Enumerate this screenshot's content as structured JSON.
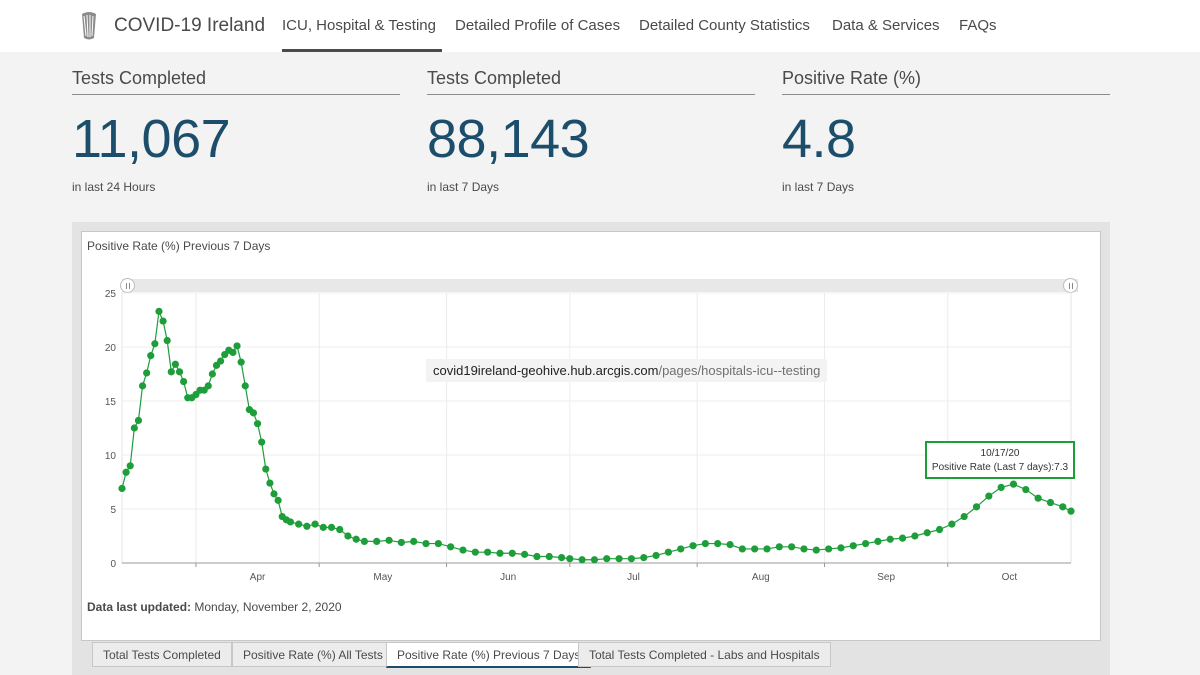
{
  "nav": {
    "site_title": "COVID-19 Ireland",
    "links": [
      "ICU, Hospital & Testing",
      "Detailed Profile of Cases",
      "Detailed County Statistics",
      "Data & Services",
      "FAQs"
    ],
    "active_index": 0
  },
  "cards": [
    {
      "title": "Tests Completed",
      "value": "11,067",
      "sub": "in last 24 Hours"
    },
    {
      "title": "Tests Completed",
      "value": "88,143",
      "sub": "in last 7 Days"
    },
    {
      "title": "Positive Rate (%)",
      "value": "4.8",
      "sub": "in last 7 Days"
    }
  ],
  "chart_panel": {
    "url_tooltip": {
      "domain": "covid19ireland-geohive.hub.arcgis.com",
      "path": "/pages/hospitals-icu--testing"
    },
    "hover_tooltip": {
      "date": "10/17/20",
      "text": "Positive Rate (Last 7 days):7.3"
    },
    "updated_label": "Data last updated:",
    "updated_value": "Monday, November 2, 2020",
    "tabs": [
      "Total Tests Completed",
      "Positive Rate (%) All Tests",
      "Positive Rate (%) Previous 7 Days",
      "Total Tests Completed - Labs and Hospitals"
    ],
    "active_tab": 2
  },
  "colors": {
    "series": "#1e9e3a",
    "value": "#1c4e6b",
    "nav_text": "#4a4a4a"
  },
  "chart_data": {
    "type": "line",
    "title": "Positive Rate (%) Previous 7 Days",
    "xlabel": "",
    "ylabel": "",
    "ylim": [
      0,
      25
    ],
    "yticks": [
      0,
      5,
      10,
      15,
      20,
      25
    ],
    "xticks": [
      {
        "label": "Apr",
        "date": "2020-04-01"
      },
      {
        "label": "May",
        "date": "2020-05-01"
      },
      {
        "label": "Jun",
        "date": "2020-06-01"
      },
      {
        "label": "Jul",
        "date": "2020-07-01"
      },
      {
        "label": "Aug",
        "date": "2020-08-01"
      },
      {
        "label": "Sep",
        "date": "2020-09-01"
      },
      {
        "label": "Oct",
        "date": "2020-10-01"
      }
    ],
    "x_range": [
      "2020-03-14",
      "2020-10-31"
    ],
    "grid": true,
    "series": [
      {
        "points": [
          [
            "2020-03-14",
            6.9
          ],
          [
            "2020-03-15",
            8.4
          ],
          [
            "2020-03-16",
            9
          ],
          [
            "2020-03-17",
            12.5
          ],
          [
            "2020-03-18",
            13.2
          ],
          [
            "2020-03-19",
            16.4
          ],
          [
            "2020-03-20",
            17.6
          ],
          [
            "2020-03-21",
            19.2
          ],
          [
            "2020-03-22",
            20.3
          ],
          [
            "2020-03-23",
            23.3
          ],
          [
            "2020-03-24",
            22.4
          ],
          [
            "2020-03-25",
            20.6
          ],
          [
            "2020-03-26",
            17.7
          ],
          [
            "2020-03-27",
            18.4
          ],
          [
            "2020-03-28",
            17.7
          ],
          [
            "2020-03-29",
            16.8
          ],
          [
            "2020-03-30",
            15.3
          ],
          [
            "2020-03-31",
            15.3
          ],
          [
            "2020-04-01",
            15.6
          ],
          [
            "2020-04-02",
            16
          ],
          [
            "2020-04-03",
            16
          ],
          [
            "2020-04-04",
            16.4
          ],
          [
            "2020-04-05",
            17.5
          ],
          [
            "2020-04-06",
            18.3
          ],
          [
            "2020-04-07",
            18.7
          ],
          [
            "2020-04-08",
            19.3
          ],
          [
            "2020-04-09",
            19.7
          ],
          [
            "2020-04-10",
            19.5
          ],
          [
            "2020-04-11",
            20.1
          ],
          [
            "2020-04-12",
            18.6
          ],
          [
            "2020-04-13",
            16.4
          ],
          [
            "2020-04-14",
            14.2
          ],
          [
            "2020-04-15",
            13.9
          ],
          [
            "2020-04-16",
            12.9
          ],
          [
            "2020-04-17",
            11.2
          ],
          [
            "2020-04-18",
            8.7
          ],
          [
            "2020-04-19",
            7.4
          ],
          [
            "2020-04-20",
            6.4
          ],
          [
            "2020-04-21",
            5.8
          ],
          [
            "2020-04-22",
            4.3
          ],
          [
            "2020-04-23",
            4
          ],
          [
            "2020-04-24",
            3.8
          ],
          [
            "2020-04-26",
            3.6
          ],
          [
            "2020-04-28",
            3.4
          ],
          [
            "2020-04-30",
            3.6
          ],
          [
            "2020-05-02",
            3.3
          ],
          [
            "2020-05-04",
            3.3
          ],
          [
            "2020-05-06",
            3.1
          ],
          [
            "2020-05-08",
            2.5
          ],
          [
            "2020-05-10",
            2.2
          ],
          [
            "2020-05-12",
            2
          ],
          [
            "2020-05-15",
            2
          ],
          [
            "2020-05-18",
            2.1
          ],
          [
            "2020-05-21",
            1.9
          ],
          [
            "2020-05-24",
            2
          ],
          [
            "2020-05-27",
            1.8
          ],
          [
            "2020-05-30",
            1.8
          ],
          [
            "2020-06-02",
            1.5
          ],
          [
            "2020-06-05",
            1.2
          ],
          [
            "2020-06-08",
            1
          ],
          [
            "2020-06-11",
            1
          ],
          [
            "2020-06-14",
            0.9
          ],
          [
            "2020-06-17",
            0.9
          ],
          [
            "2020-06-20",
            0.8
          ],
          [
            "2020-06-23",
            0.6
          ],
          [
            "2020-06-26",
            0.6
          ],
          [
            "2020-06-29",
            0.5
          ],
          [
            "2020-07-01",
            0.4
          ],
          [
            "2020-07-04",
            0.3
          ],
          [
            "2020-07-07",
            0.3
          ],
          [
            "2020-07-10",
            0.4
          ],
          [
            "2020-07-13",
            0.4
          ],
          [
            "2020-07-16",
            0.4
          ],
          [
            "2020-07-19",
            0.5
          ],
          [
            "2020-07-22",
            0.7
          ],
          [
            "2020-07-25",
            1
          ],
          [
            "2020-07-28",
            1.3
          ],
          [
            "2020-07-31",
            1.6
          ],
          [
            "2020-08-03",
            1.8
          ],
          [
            "2020-08-06",
            1.8
          ],
          [
            "2020-08-09",
            1.7
          ],
          [
            "2020-08-12",
            1.3
          ],
          [
            "2020-08-15",
            1.3
          ],
          [
            "2020-08-18",
            1.3
          ],
          [
            "2020-08-21",
            1.5
          ],
          [
            "2020-08-24",
            1.5
          ],
          [
            "2020-08-27",
            1.3
          ],
          [
            "2020-08-30",
            1.2
          ],
          [
            "2020-09-02",
            1.3
          ],
          [
            "2020-09-05",
            1.4
          ],
          [
            "2020-09-08",
            1.6
          ],
          [
            "2020-09-11",
            1.8
          ],
          [
            "2020-09-14",
            2
          ],
          [
            "2020-09-17",
            2.2
          ],
          [
            "2020-09-20",
            2.3
          ],
          [
            "2020-09-23",
            2.5
          ],
          [
            "2020-09-26",
            2.8
          ],
          [
            "2020-09-29",
            3.1
          ],
          [
            "2020-10-02",
            3.6
          ],
          [
            "2020-10-05",
            4.3
          ],
          [
            "2020-10-08",
            5.2
          ],
          [
            "2020-10-11",
            6.2
          ],
          [
            "2020-10-14",
            7
          ],
          [
            "2020-10-17",
            7.3
          ],
          [
            "2020-10-20",
            6.8
          ],
          [
            "2020-10-23",
            6
          ],
          [
            "2020-10-26",
            5.6
          ],
          [
            "2020-10-29",
            5.2
          ],
          [
            "2020-10-31",
            4.8
          ]
        ]
      }
    ]
  }
}
